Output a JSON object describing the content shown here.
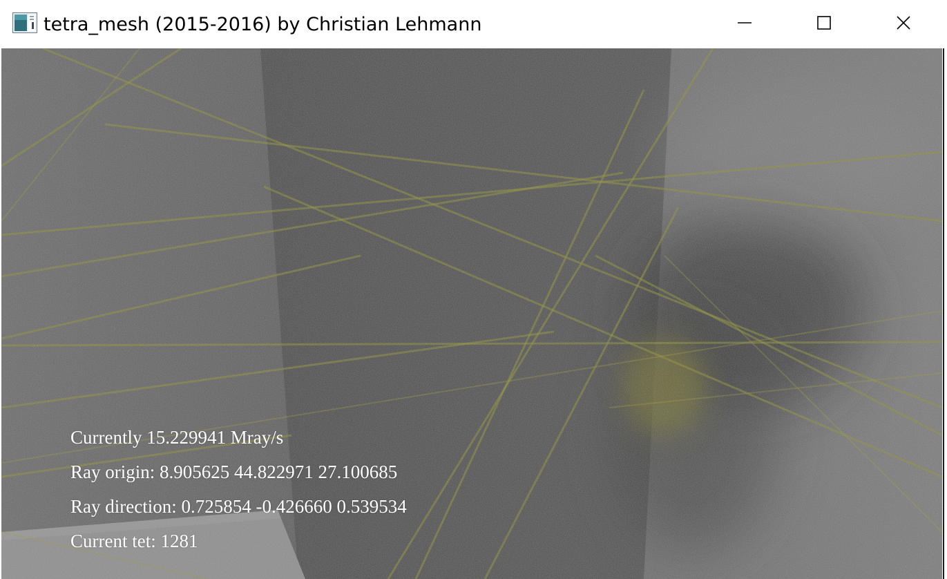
{
  "window": {
    "title": "tetra_mesh (2015-2016) by Christian Lehmann",
    "icon": "app-window-icon",
    "controls": {
      "minimize_icon": "minimize-icon",
      "maximize_icon": "maximize-icon",
      "close_icon": "close-icon"
    }
  },
  "overlay": {
    "rate_line": "Currently 15.229941 Mray/s",
    "origin_line": "Ray origin: 8.905625 44.822971 27.100685",
    "direction_line": "Ray direction: 0.725854 -0.426660 0.539534",
    "tet_line": "Current tet: 1281"
  },
  "colors": {
    "titlebar_bg": "#ffffff",
    "overlay_text": "#ffffff",
    "mesh_lines": "#8a8a30",
    "scene_gray": "#5b5b5b"
  }
}
